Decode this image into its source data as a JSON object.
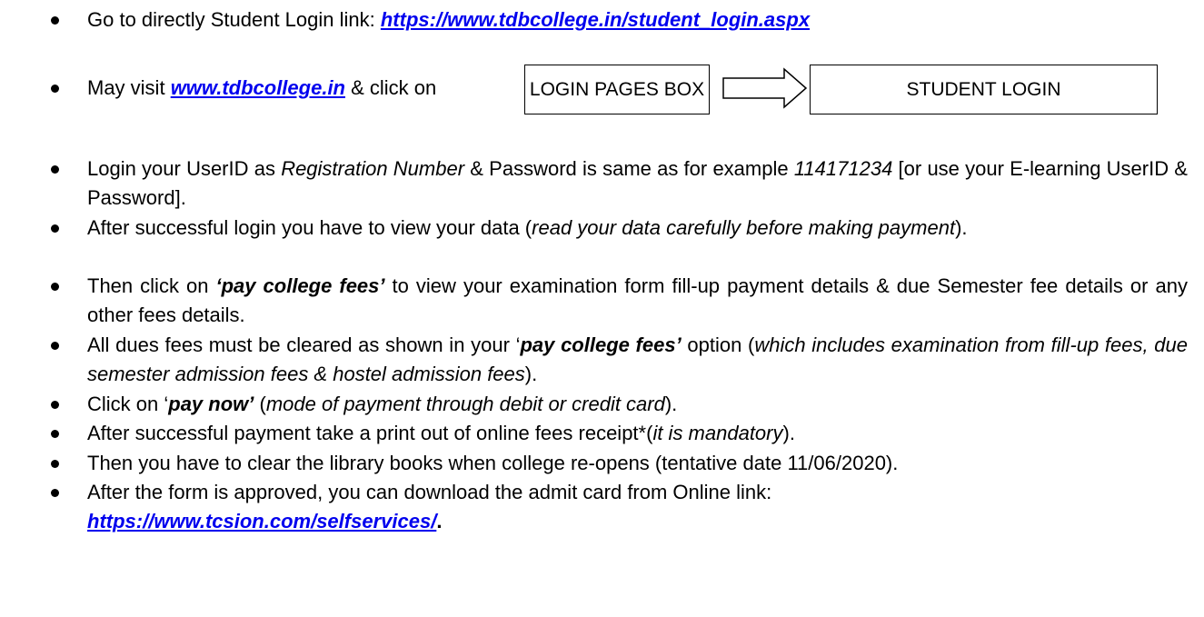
{
  "b1": {
    "text": "Go to directly Student Login link: ",
    "link": "https://www.tdbcollege.in/student_login.aspx"
  },
  "b2": {
    "pre": "May visit ",
    "link": "www.tdbcollege.in",
    "post": " & click on",
    "box1": "LOGIN PAGES BOX",
    "box2": "STUDENT LOGIN"
  },
  "b3": {
    "t1": "Login your UserID as ",
    "i1": "Registration Number",
    "t2": " & Password is same as for example ",
    "i2": "114171234",
    "t3": " [or use your E-learning UserID & Password]."
  },
  "b4": {
    "t1": "After successful login you have to view your data (",
    "i1": "read your data carefully before making payment",
    "t2": ")."
  },
  "b5": {
    "t1": "Then click on ",
    "bi1": "‘pay college fees’",
    "t2": " to view your examination form fill-up payment details & due Semester fee details or any other fees details."
  },
  "b6": {
    "t1": "All dues fees must be cleared as shown in your ‘",
    "bi1": "pay college fees’",
    "t2": " option (",
    "i1": "which includes examination from fill-up fees, due semester admission fees & hostel admission fees",
    "t3": ")."
  },
  "b7": {
    "t1": "Click on ‘",
    "bi1": "pay now’",
    "t2": " (",
    "i1": "mode of payment through debit or credit card",
    "t3": ")."
  },
  "b8": {
    "t1": "After successful payment take a print out of online fees receipt*(",
    "i1": "it is mandatory",
    "t2": ")."
  },
  "b9": {
    "text": "Then you have to clear the library books when college re-opens (tentative date 11/06/2020)."
  },
  "b10": {
    "t1": "After the form is approved, you can download the admit card from Online link:",
    "link": "https://www.tcsion.com/selfservices/",
    "t2": "."
  }
}
